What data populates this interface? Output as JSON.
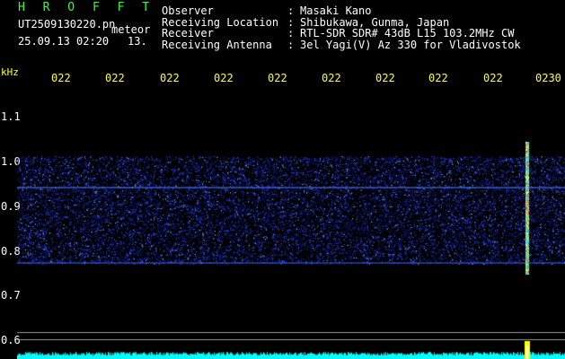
{
  "header": {
    "app_title": "H R O F F T",
    "filename": "UT2509130220.pn",
    "mode_label": "meteor",
    "datetime": "25.09.13 02:20",
    "count": "13."
  },
  "info": [
    {
      "label": "Observer",
      "sep": ":",
      "value": "Masaki Kano"
    },
    {
      "label": "Receiving Location",
      "sep": ":",
      "value": "Shibukawa, Gunma, Japan"
    },
    {
      "label": "Receiver",
      "sep": ":",
      "value": "RTL-SDR SDR# 43dB L15 103.2MHz CW"
    },
    {
      "label": "Receiving Antenna",
      "sep": ":",
      "value": "3el Yagi(V) Az 330 for Vladivostok"
    }
  ],
  "axis": {
    "unit_label": "kHz",
    "time_ticks": [
      "022",
      "022",
      "022",
      "022",
      "022",
      "022",
      "022",
      "022",
      "022",
      "0230"
    ],
    "freq_ticks": [
      "1.1",
      "1.0",
      "0.9",
      "0.8",
      "0.7",
      "0.6"
    ]
  },
  "colors": {
    "background": "#000000",
    "text_white": "#ffffff",
    "title_green": "#33ff33",
    "tick_yellow": "#ffff44",
    "noise_blue": "#2244ff",
    "baseline_cyan": "#00ffff",
    "meteor_yellow": "#ffff00"
  }
}
